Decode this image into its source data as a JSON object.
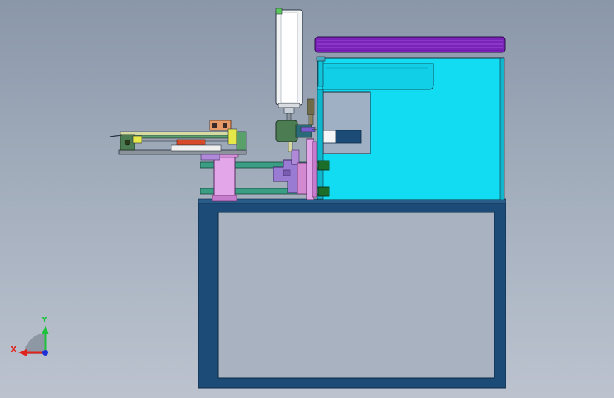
{
  "viewport": {
    "background_top": "#8a97a9",
    "background_bottom": "#bcc3cf"
  },
  "colors": {
    "frame": "#1c4b78",
    "enclosure": "#12dcf2",
    "roof": "#7b22b8",
    "guide_rod": "#3a9e84",
    "pink_block": "#e3a6e8",
    "purple_block": "#9a7bd3",
    "cylinder_body": "#f2f3f4",
    "motor": "#4c7d52"
  },
  "triad": {
    "x_label": "X",
    "y_label": "Y",
    "x_color": "#e0231d",
    "y_color": "#1ec23a",
    "z_color": "#1f2fd8"
  }
}
